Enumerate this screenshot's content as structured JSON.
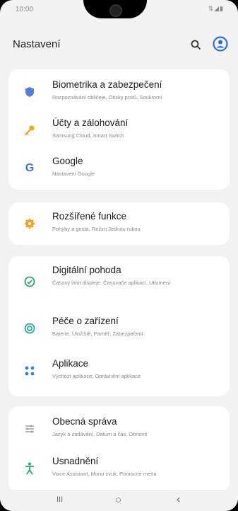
{
  "status": {
    "time": "10:00",
    "icons": "⇅◢▮"
  },
  "header": {
    "title": "Nastavení"
  },
  "groups": [
    {
      "items": [
        {
          "label": "Biometrika a zabezpečení",
          "sub": "Rozpoznávání obličeje, Otisky prstů, Soukromí",
          "icon": "shield-icon",
          "color": "#5a7bd6"
        },
        {
          "label": "Účty a zálohování",
          "sub": "Samsung Cloud, Smart Switch",
          "icon": "key-icon",
          "color": "#f2a21b"
        },
        {
          "label": "Google",
          "sub": "Nastavení Google",
          "icon": "google-icon",
          "color": "#3f6fd8"
        }
      ]
    },
    {
      "items": [
        {
          "label": "Rozšířené funkce",
          "sub": "Pohyby a gesta, Režim Jednou rukou",
          "icon": "gear-plus-icon",
          "color": "#f2a21b"
        }
      ]
    },
    {
      "items": [
        {
          "label": "Digitální pohoda",
          "sub": "Časový limit displeje, Časovače aplikací, Utlumení",
          "icon": "wellbeing-icon",
          "color": "#2fa36b"
        },
        {
          "label": "Péče o zařízení",
          "sub": "Baterie, Úložiště, Paměť, Zabezpečení",
          "icon": "device-care-icon",
          "color": "#27a99b"
        },
        {
          "label": "Aplikace",
          "sub": "Výchozí aplikace, Oprávnění aplikace",
          "icon": "apps-grid-icon",
          "color": "#3c7fd6"
        }
      ]
    },
    {
      "items": [
        {
          "label": "Obecná správa",
          "sub": "Jazyk a zadávání, Datum a čas, Obnovit",
          "icon": "sliders-icon",
          "color": "#9aa0a6"
        },
        {
          "label": "Usnadnění",
          "sub": "Voice Assistant, Mono zvuk, Pomocné menu",
          "icon": "accessibility-icon",
          "color": "#2fa36b"
        }
      ]
    }
  ],
  "nav": {
    "recents": "III",
    "home": "○",
    "back": "‹"
  }
}
